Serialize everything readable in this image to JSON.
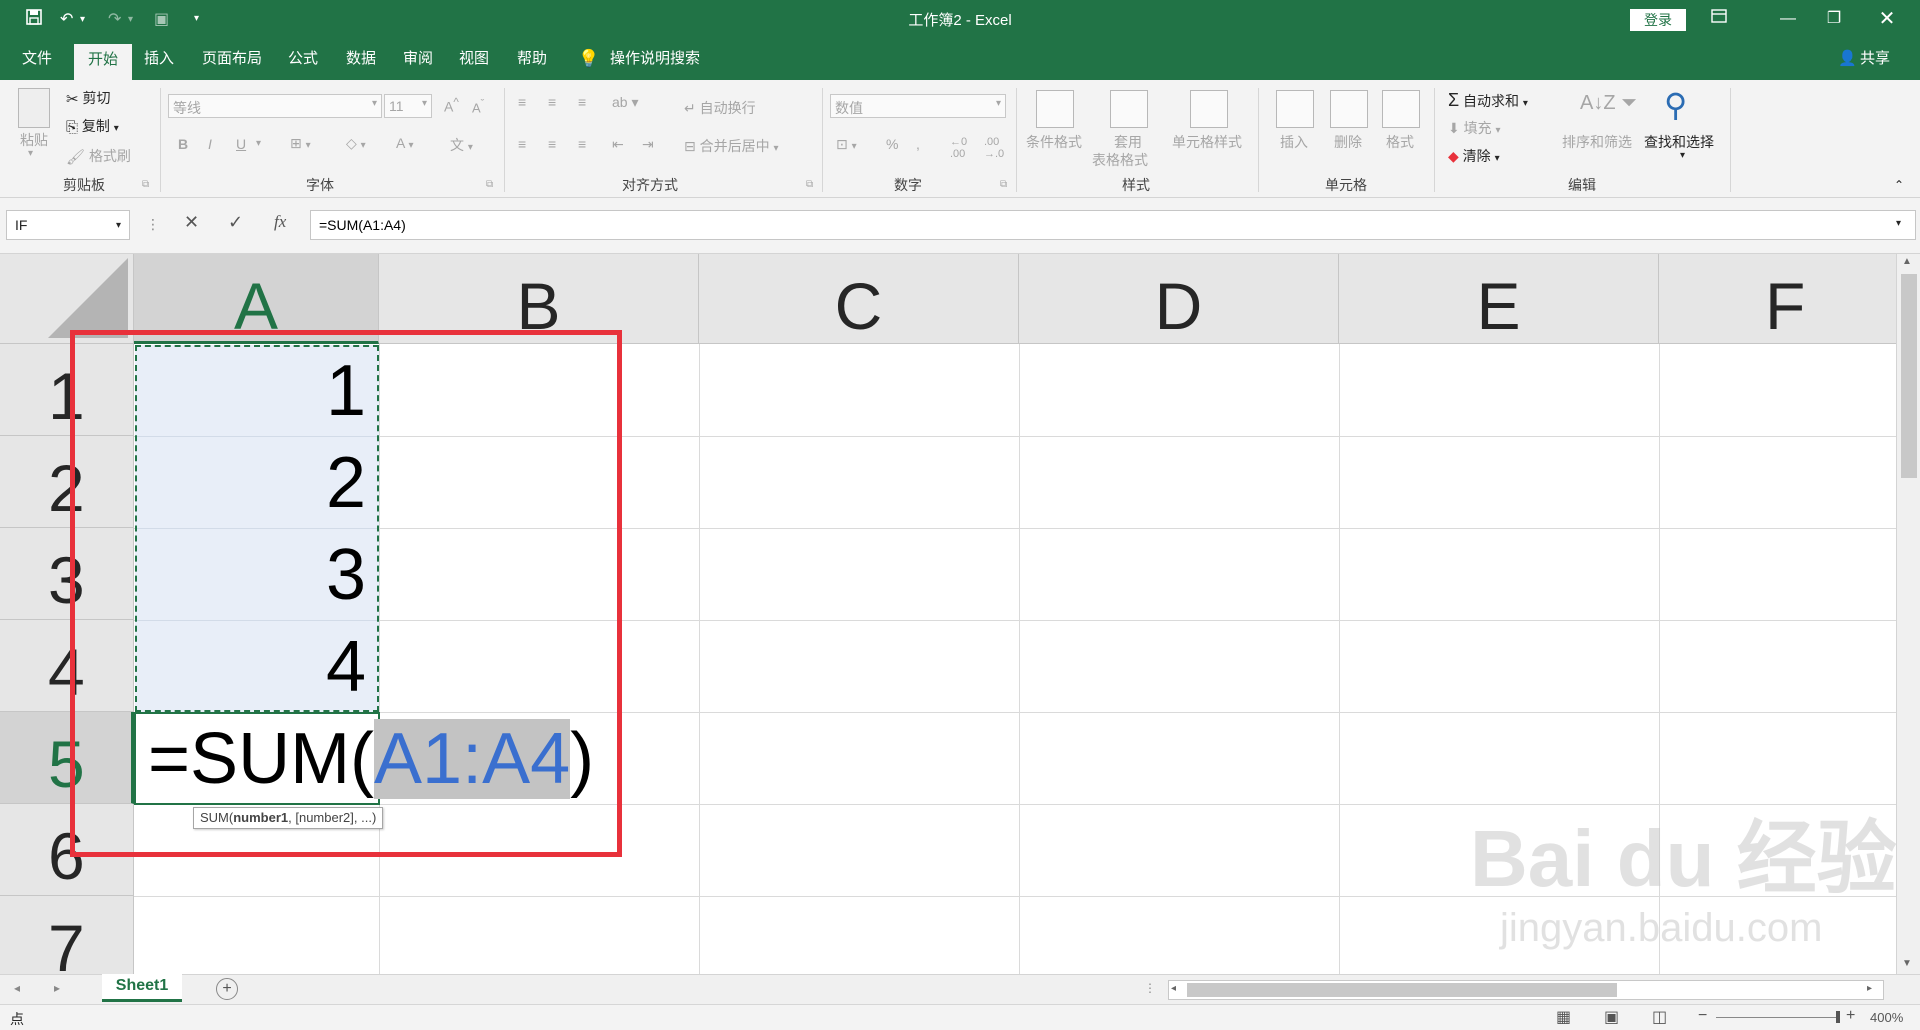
{
  "title_bar": {
    "title": "工作簿2  -  Excel",
    "login": "登录",
    "qat_icons": [
      "save-icon",
      "undo-icon",
      "redo-icon",
      "touch-mode-icon",
      "customize-qat-icon"
    ],
    "window_icons": [
      "ribbon-display-icon",
      "minimize-icon",
      "restore-icon",
      "close-icon"
    ]
  },
  "tabs": [
    "文件",
    "开始",
    "插入",
    "页面布局",
    "公式",
    "数据",
    "审阅",
    "视图",
    "帮助"
  ],
  "active_tab": "开始",
  "tell_me": "操作说明搜索",
  "share": "共享",
  "ribbon": {
    "clipboard": {
      "label": "剪贴板",
      "paste": "粘贴",
      "cut": "剪切",
      "copy": "复制",
      "format_painter": "格式刷"
    },
    "font": {
      "label": "字体",
      "font_name": "等线",
      "font_size": "11",
      "bold": "B",
      "italic": "I",
      "underline": "U"
    },
    "alignment": {
      "label": "对齐方式",
      "wrap": "自动换行",
      "merge": "合并后居中"
    },
    "number": {
      "label": "数字",
      "format": "数值",
      "percent": "%"
    },
    "styles": {
      "label": "样式",
      "conditional": "条件格式",
      "table_line1": "套用",
      "table_line2": "表格格式",
      "cell_styles": "单元格样式"
    },
    "cells": {
      "label": "单元格",
      "insert": "插入",
      "delete": "删除",
      "format": "格式"
    },
    "editing": {
      "label": "编辑",
      "autosum": "自动求和",
      "fill": "填充",
      "clear": "清除",
      "sort": "排序和筛选",
      "find": "查找和选择"
    }
  },
  "formula_bar": {
    "name_box": "IF",
    "formula": "=SUM(A1:A4)",
    "fx": "fx"
  },
  "columns": [
    "A",
    "B",
    "C",
    "D",
    "E",
    "F"
  ],
  "rows": [
    "1",
    "2",
    "3",
    "4",
    "5",
    "6",
    "7"
  ],
  "cells": {
    "A1": "1",
    "A2": "2",
    "A3": "3",
    "A4": "4"
  },
  "edit_cell": {
    "prefix": "=SUM(",
    "range": "A1:A4",
    "suffix": ")"
  },
  "tooltip": {
    "func": "SUM(",
    "arg1": "number1",
    "rest": ", [number2], ...)"
  },
  "sheet_tabs": [
    "Sheet1"
  ],
  "status": {
    "mode": "点",
    "zoom": "400%"
  },
  "watermark": {
    "brand": "Bai du 经验",
    "url": "jingyan.baidu.com"
  },
  "colors": {
    "excel_green": "#217346",
    "selection_fill": "#e8eef8",
    "highlight_red": "#e8313b",
    "range_blue": "#3a6fcf"
  }
}
